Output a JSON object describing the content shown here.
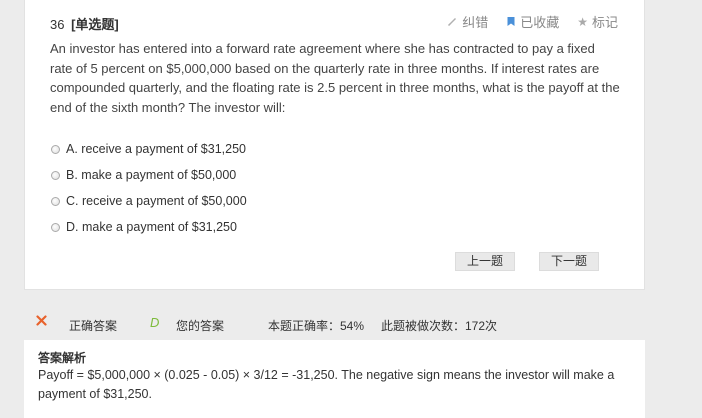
{
  "question": {
    "number": "36",
    "type_label": "[单选题]",
    "stem": "An investor has entered into a forward rate agreement where she has contracted to pay a fixed rate of 5 percent on $5,000,000 based on the quarterly rate in three months. If interest rates are compounded quarterly, and the floating rate is 2.5 percent in three months, what is the payoff at the end of the sixth month? The investor will:",
    "options": [
      {
        "label": "A. receive a payment of $31,250"
      },
      {
        "label": "B. make a payment of $50,000"
      },
      {
        "label": "C. receive a payment of $50,000"
      },
      {
        "label": "D. make a payment of $31,250"
      }
    ]
  },
  "tools": {
    "report_error": "纠错",
    "favorited": "已收藏",
    "mark": "标记",
    "colors": {
      "icon_gray": "#b0b0b0",
      "favorite_blue": "#4a90d9"
    }
  },
  "nav": {
    "prev": "上一题",
    "next": "下一题"
  },
  "result": {
    "correct_label": "正确答案",
    "correct_icon": "✕",
    "my_answer_letter": "D",
    "my_answer_label": "您的答案",
    "accuracy_text": "本题正确率：54%",
    "count_text": "此题被做次数：172次",
    "colors": {
      "cross": "#e8622c",
      "my_answer": "#7dbb3c"
    }
  },
  "explanation": {
    "title": "答案解析",
    "body": "Payoff = $5,000,000 × (0.025 - 0.05) × 3/12 = -31,250. The negative sign means the investor will make a payment of $31,250."
  }
}
